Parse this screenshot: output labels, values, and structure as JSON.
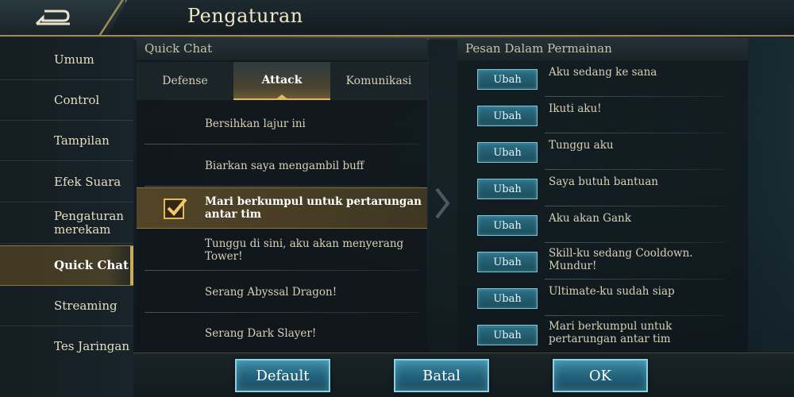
{
  "header": {
    "title": "Pengaturan"
  },
  "sidebar": {
    "items": [
      {
        "label": "Umum"
      },
      {
        "label": "Control"
      },
      {
        "label": "Tampilan"
      },
      {
        "label": "Efek Suara"
      },
      {
        "label": "Pengaturan merekam"
      },
      {
        "label": "Quick Chat",
        "active": true
      },
      {
        "label": "Streaming"
      },
      {
        "label": "Tes Jaringan"
      }
    ]
  },
  "quick_chat": {
    "title": "Quick Chat",
    "tabs": [
      {
        "label": "Defense"
      },
      {
        "label": "Attack",
        "active": true
      },
      {
        "label": "Komunikasi"
      }
    ],
    "items": [
      {
        "label": "Bersihkan lajur ini"
      },
      {
        "label": "Biarkan saya mengambil buff"
      },
      {
        "label": "Mari berkumpul untuk pertarungan antar tim",
        "selected": true
      },
      {
        "label": "Tunggu di sini, aku akan menyerang Tower!"
      },
      {
        "label": "Serang Abyssal Dragon!"
      },
      {
        "label": "Serang Dark Slayer!"
      }
    ]
  },
  "game_messages": {
    "title": "Pesan Dalam Permainan",
    "edit_label": "Ubah",
    "items": [
      {
        "text": "Aku sedang ke sana"
      },
      {
        "text": "Ikuti aku!"
      },
      {
        "text": "Tunggu aku"
      },
      {
        "text": "Saya butuh bantuan"
      },
      {
        "text": "Aku akan Gank"
      },
      {
        "text": "Skill-ku sedang Cooldown. Mundur!"
      },
      {
        "text": "Ultimate-ku sudah siap"
      },
      {
        "text": "Mari berkumpul untuk pertarungan antar tim"
      }
    ]
  },
  "footer": {
    "default_label": "Default",
    "cancel_label": "Batal",
    "ok_label": "OK"
  },
  "colors": {
    "gold_accent": "#e0b85e",
    "button_teal": "#23607a",
    "selected_bg": "#5a4a28"
  }
}
